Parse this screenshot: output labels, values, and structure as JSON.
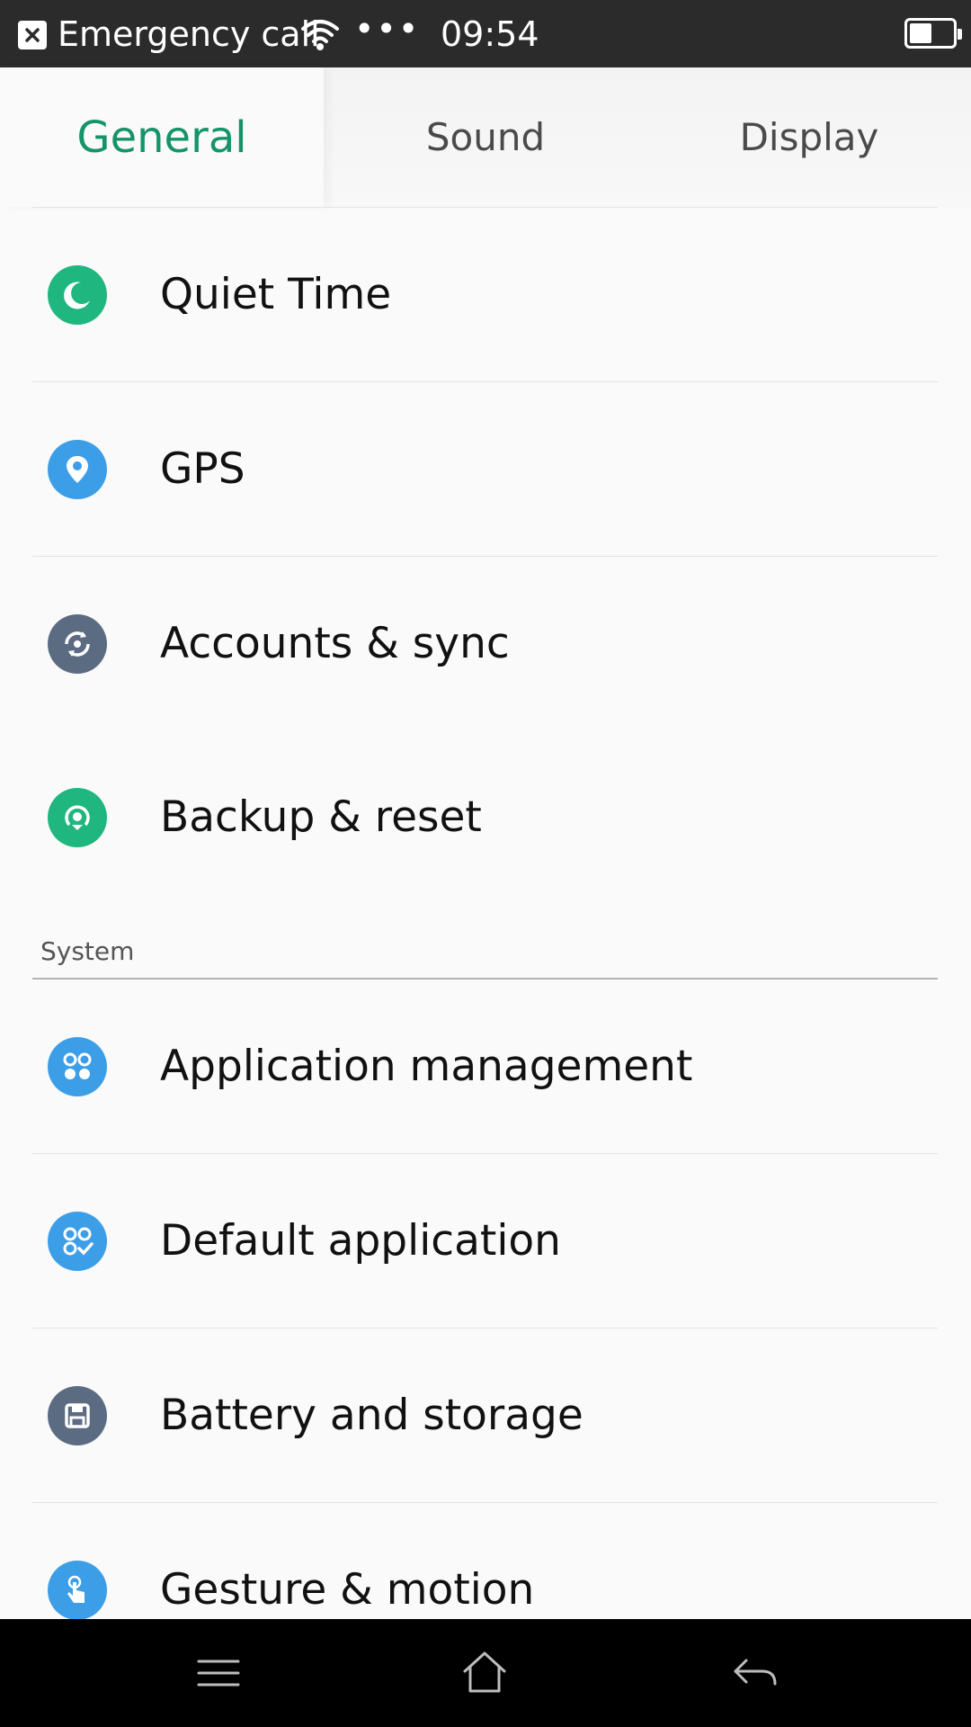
{
  "status_bar": {
    "carrier_text": "Emergency call",
    "dots": "•••",
    "time": "09:54",
    "icons": [
      "sim-missing-icon",
      "wifi-icon",
      "battery-icon"
    ]
  },
  "tabs": [
    {
      "label": "General",
      "active": true
    },
    {
      "label": "Sound",
      "active": false
    },
    {
      "label": "Display",
      "active": false
    }
  ],
  "colors": {
    "accent": "#15946a",
    "green_icon": "#1fb67f",
    "blue_icon": "#3d9ee8",
    "slate_icon": "#5b6b82"
  },
  "list": {
    "items_general": [
      {
        "label": "Quiet Time",
        "icon": "moon-icon"
      },
      {
        "label": "GPS",
        "icon": "location-pin-icon"
      },
      {
        "label": "Accounts & sync",
        "icon": "sync-icon"
      },
      {
        "label": "Backup & reset",
        "icon": "backup-icon"
      }
    ],
    "section_system": "System",
    "items_system": [
      {
        "label": "Application management",
        "icon": "apps-icon"
      },
      {
        "label": "Default application",
        "icon": "default-apps-icon"
      },
      {
        "label": "Battery and storage",
        "icon": "storage-icon"
      },
      {
        "label": "Gesture & motion",
        "icon": "gesture-icon"
      }
    ]
  },
  "nav_bar": {
    "buttons": [
      "menu-icon",
      "home-icon",
      "back-icon"
    ]
  }
}
